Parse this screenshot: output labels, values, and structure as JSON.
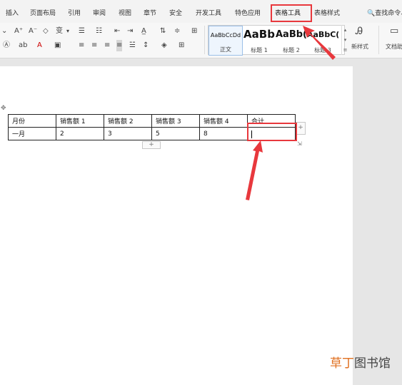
{
  "ribbon": {
    "tabs": [
      {
        "id": "insert",
        "label": "插入"
      },
      {
        "id": "layout",
        "label": "页面布局"
      },
      {
        "id": "references",
        "label": "引用"
      },
      {
        "id": "review",
        "label": "审阅"
      },
      {
        "id": "view",
        "label": "视图"
      },
      {
        "id": "chapter",
        "label": "章节"
      },
      {
        "id": "security",
        "label": "安全"
      },
      {
        "id": "developer",
        "label": "开发工具"
      },
      {
        "id": "features",
        "label": "特色应用"
      },
      {
        "id": "table_tools",
        "label": "表格工具"
      },
      {
        "id": "table_styles",
        "label": "表格样式"
      }
    ],
    "search_label": "查找命令、"
  },
  "toolbar": {
    "font_grow": "A⁺",
    "font_shrink": "A⁻",
    "phonetic": "变",
    "styles": [
      {
        "sample": "AaBbCcDd",
        "name": "正文"
      },
      {
        "sample": "AaBb",
        "name": "标题 1"
      },
      {
        "sample": "AaBb(",
        "name": "标题 2"
      },
      {
        "sample": "AaBbC(",
        "name": "标题 3"
      }
    ],
    "new_style_label": "新样式",
    "doc_label": "文档助"
  },
  "table": {
    "header": [
      "月份",
      "销售额 1",
      "销售额 2",
      "销售额 3",
      "销售额 4",
      "合计"
    ],
    "rows": [
      [
        "一月",
        "2",
        "3",
        "5",
        "8",
        ""
      ]
    ]
  },
  "watermark": {
    "part1": "草丁",
    "part2": "图书馆"
  },
  "colors": {
    "annotation_red": "#e8383d",
    "watermark_orange": "#e07020"
  }
}
